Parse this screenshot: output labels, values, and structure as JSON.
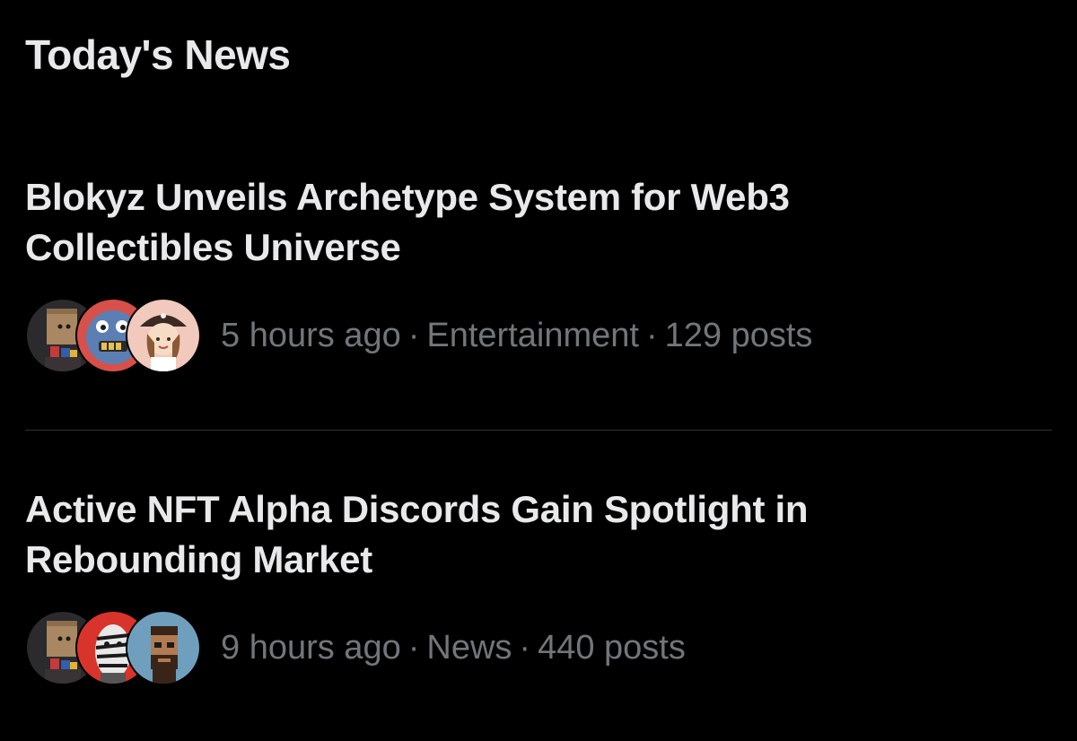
{
  "section": {
    "title": "Today's News"
  },
  "news": [
    {
      "headline": "Blokyz Unveils Archetype System for Web3 Collectibles Universe",
      "time": "5 hours ago",
      "category": "Entertainment",
      "posts": "129 posts",
      "avatars": [
        "box-head-avatar",
        "blue-monster-avatar",
        "pirate-girl-avatar"
      ]
    },
    {
      "headline": "Active NFT Alpha Discords Gain Spotlight in Rebounding Market",
      "time": "9 hours ago",
      "category": "News",
      "posts": "440 posts",
      "avatars": [
        "box-head-avatar",
        "zebra-avatar",
        "pixel-punk-avatar"
      ]
    }
  ],
  "separator": "·",
  "colors": {
    "background": "#000000",
    "headline_text": "#e7e9ea",
    "meta_text": "#71767b",
    "divider": "#2f3336"
  }
}
